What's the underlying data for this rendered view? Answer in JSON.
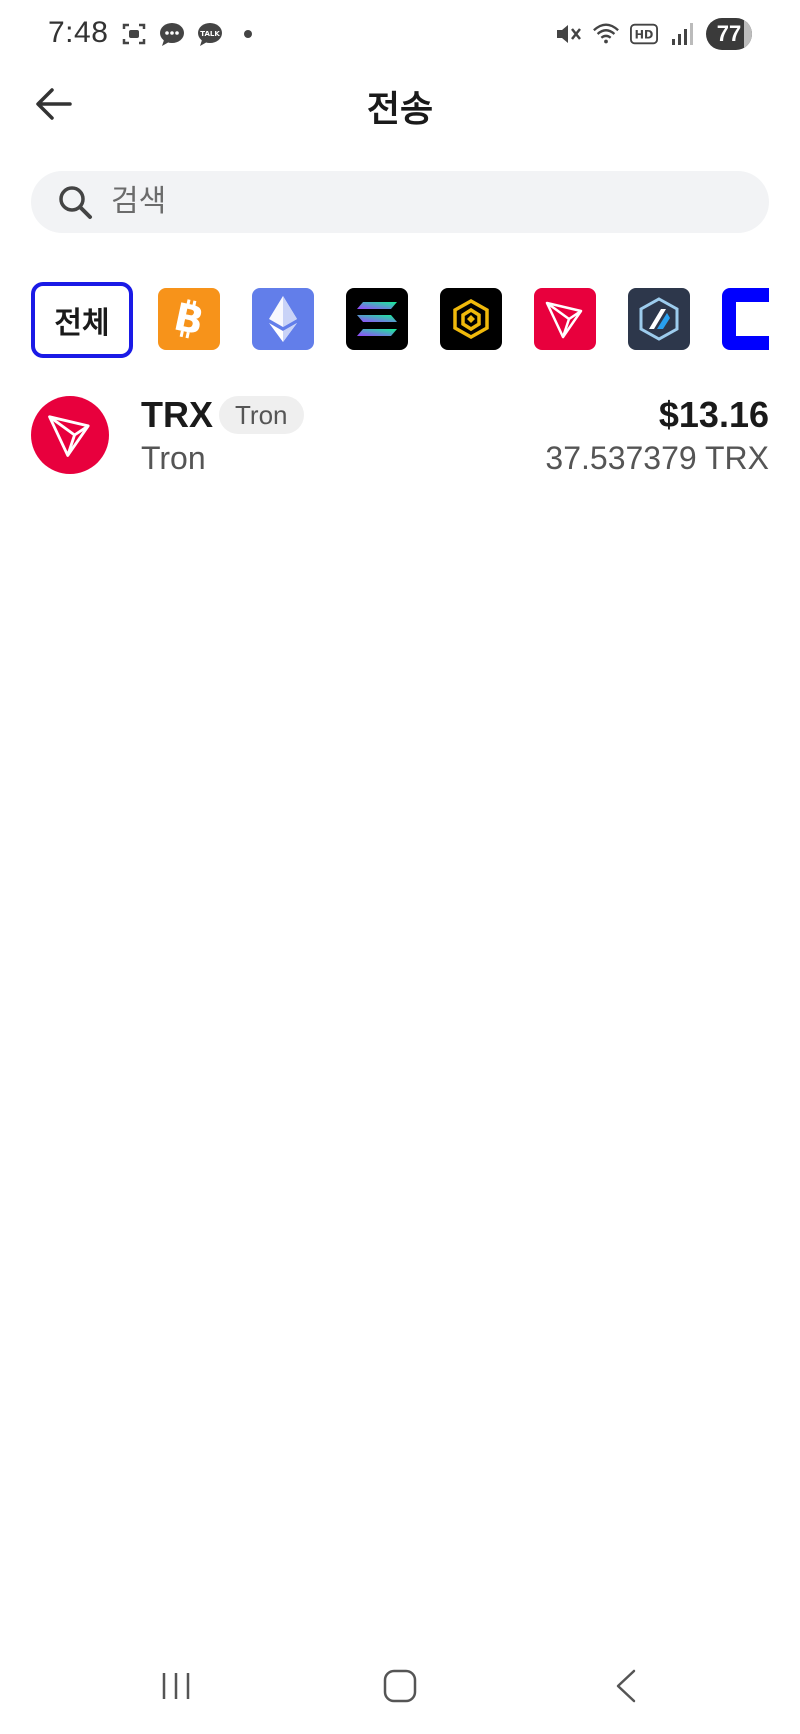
{
  "status_bar": {
    "time": "7:48",
    "battery": "77",
    "left_icons": [
      "screenshot-icon",
      "chat-bubble-icon",
      "talk-icon",
      "dot-icon"
    ],
    "right_icons": [
      "mute-icon",
      "wifi-icon",
      "hd-icon",
      "signal-icon",
      "battery-icon"
    ]
  },
  "header": {
    "title": "전송",
    "back_icon": "arrow-left-icon"
  },
  "search": {
    "placeholder": "검색",
    "icon": "search-icon"
  },
  "chain_filter": {
    "all_label": "전체",
    "chains": [
      {
        "name": "bitcoin",
        "color": "#f7931a"
      },
      {
        "name": "ethereum",
        "color": "#627eea"
      },
      {
        "name": "solana",
        "color": "#000000"
      },
      {
        "name": "bnb",
        "color": "#000000"
      },
      {
        "name": "tron",
        "color": "#e8003d"
      },
      {
        "name": "arbitrum",
        "color": "#2d374b"
      },
      {
        "name": "unknown",
        "color": "#0000ff"
      }
    ]
  },
  "tokens": [
    {
      "symbol": "TRX",
      "badge": "Tron",
      "name": "Tron",
      "value": "$13.16",
      "amount": "37.537379 TRX",
      "logo_color": "#e8003d"
    }
  ],
  "nav_bar": {
    "icons": [
      "recent-apps-icon",
      "home-icon",
      "back-icon"
    ]
  }
}
